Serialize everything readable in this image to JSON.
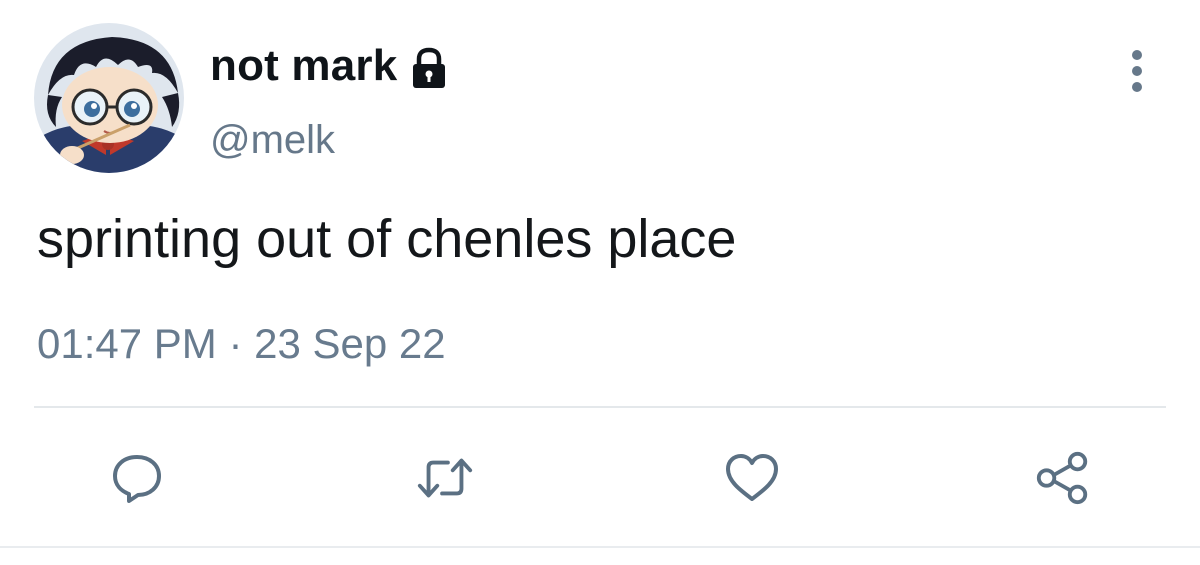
{
  "tweet": {
    "display_name": "not mark",
    "handle": "@melk",
    "text": "sprinting out of chenles place",
    "timestamp": "01:47 PM · 23 Sep 22",
    "protected_icon": "lock-icon",
    "more_icon": "vertical-dots-icon"
  },
  "actions": [
    {
      "name": "reply",
      "icon": "speech-bubble-icon"
    },
    {
      "name": "retweet",
      "icon": "retweet-arrows-icon"
    },
    {
      "name": "like",
      "icon": "heart-icon"
    },
    {
      "name": "share",
      "icon": "share-nodes-icon"
    }
  ],
  "colors": {
    "text_primary": "#0f1419",
    "text_secondary": "#687b8e",
    "icon": "#5b7083",
    "divider": "#e4e8eb"
  }
}
